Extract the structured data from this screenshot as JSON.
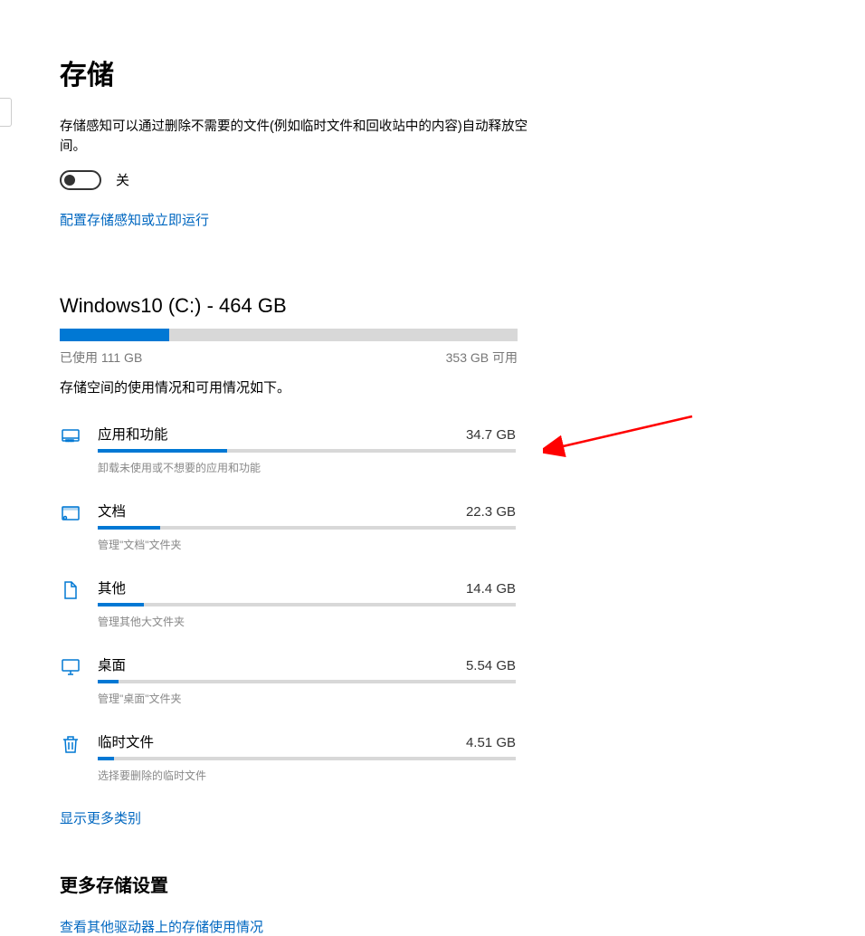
{
  "page": {
    "title": "存储",
    "storage_sense_desc": "存储感知可以通过删除不需要的文件(例如临时文件和回收站中的内容)自动释放空间。",
    "toggle_state": "关",
    "configure_link": "配置存储感知或立即运行",
    "show_more_link": "显示更多类别",
    "more_settings_title": "更多存储设置",
    "other_drives_link": "查看其他驱动器上的存储使用情况"
  },
  "drive": {
    "title": "Windows10 (C:) - 464 GB",
    "used_label": "已使用 111 GB",
    "available_label": "353 GB 可用",
    "usage_percent": 24,
    "breakdown_desc": "存储空间的使用情况和可用情况如下。"
  },
  "categories": [
    {
      "name": "应用和功能",
      "size": "34.7 GB",
      "percent": 31,
      "sub": "卸载未使用或不想要的应用和功能",
      "icon": "apps"
    },
    {
      "name": "文档",
      "size": "22.3 GB",
      "percent": 15,
      "sub": "管理\"文档\"文件夹",
      "icon": "documents"
    },
    {
      "name": "其他",
      "size": "14.4 GB",
      "percent": 11,
      "sub": "管理其他大文件夹",
      "icon": "other"
    },
    {
      "name": "桌面",
      "size": "5.54 GB",
      "percent": 5,
      "sub": "管理\"桌面\"文件夹",
      "icon": "desktop"
    },
    {
      "name": "临时文件",
      "size": "4.51 GB",
      "percent": 4,
      "sub": "选择要删除的临时文件",
      "icon": "temp"
    }
  ],
  "colors": {
    "accent": "#0078d4",
    "link": "#0067c0",
    "bar_bg": "#d8d8d8",
    "arrow": "#ff0000"
  }
}
